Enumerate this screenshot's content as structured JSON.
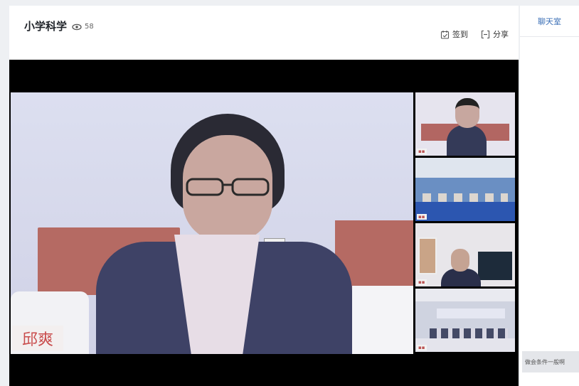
{
  "header": {
    "title": "小学科学",
    "view_count": "58",
    "actions": [
      {
        "label": "签到",
        "icon": "sign-in-icon"
      },
      {
        "label": "分享",
        "icon": "share-icon"
      }
    ]
  },
  "video": {
    "speaker_name": "邱爽"
  },
  "sidebar": {
    "tab_label": "聊天室",
    "message_text": "做会条件一般啊"
  }
}
